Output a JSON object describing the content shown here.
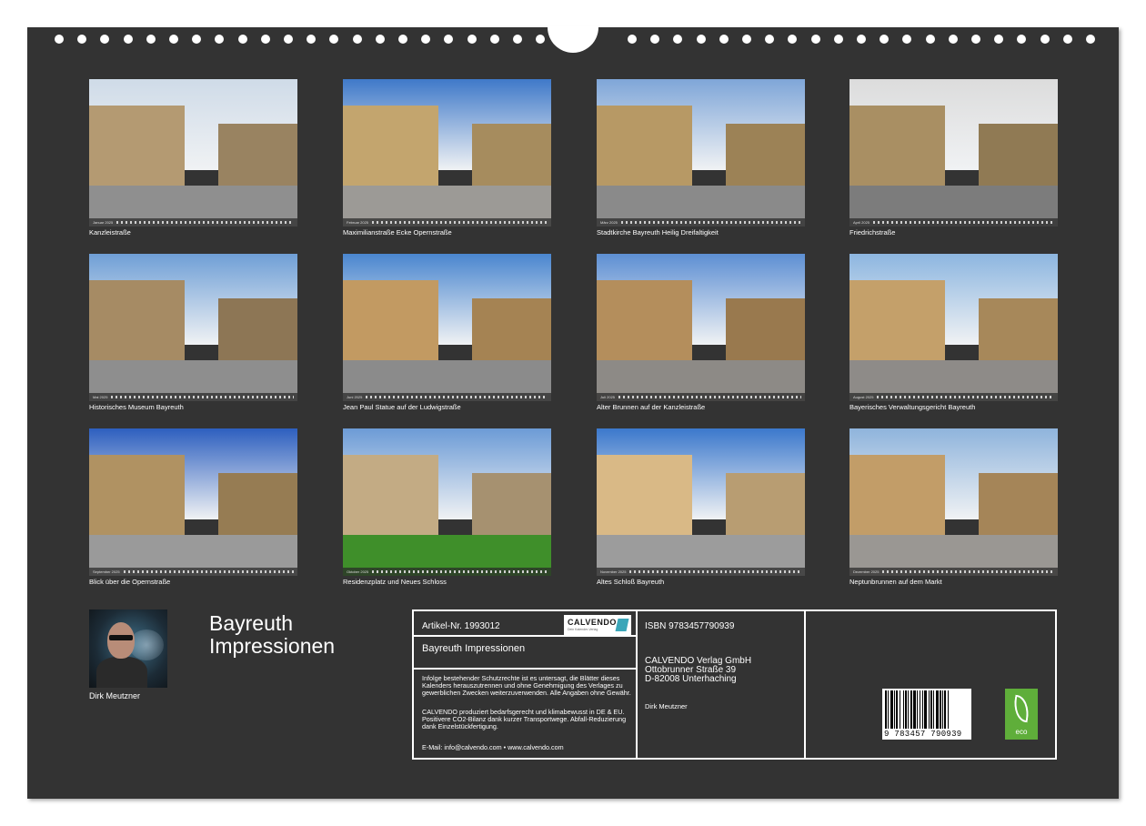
{
  "calendar": {
    "title_line1": "Bayreuth",
    "title_line2": "Impressionen",
    "author": "Dirk Meutzner"
  },
  "photos": [
    {
      "caption": "Kanzleistraße",
      "month": "Januar 2025",
      "sky": "#cfdbe8",
      "wall": "#b49a72",
      "ground": "#8f8f8f"
    },
    {
      "caption": "Maximilianstraße Ecke Opernstraße",
      "month": "Februar 2025",
      "sky": "#3f79c9",
      "wall": "#c3a56e",
      "ground": "#9c9a96"
    },
    {
      "caption": "Stadtkirche Bayreuth Heilig Dreifaltigkeit",
      "month": "März 2025",
      "sky": "#7fa6d8",
      "wall": "#b79965",
      "ground": "#8a8a8a"
    },
    {
      "caption": "Friedrichstraße",
      "month": "April 2025",
      "sky": "#dcdcdc",
      "wall": "#a98f63",
      "ground": "#7c7c7c"
    },
    {
      "caption": "Historisches Museum Bayreuth",
      "month": "Mai 2025",
      "sky": "#6f9fd6",
      "wall": "#a68b64",
      "ground": "#8e8e8e"
    },
    {
      "caption": "Jean Paul Statue auf der Ludwigstraße",
      "month": "Juni 2025",
      "sky": "#4a86cf",
      "wall": "#c29a62",
      "ground": "#8b8b8b"
    },
    {
      "caption": "Alter Brunnen auf der Kanzleistraße",
      "month": "Juli 2025",
      "sky": "#5d8fd3",
      "wall": "#b48e5c",
      "ground": "#8d8a86"
    },
    {
      "caption": "Bayerisches Verwaltungsgericht Bayreuth",
      "month": "August 2025",
      "sky": "#8db6e0",
      "wall": "#c4a06a",
      "ground": "#8e8b88"
    },
    {
      "caption": "Blick über die Opernstraße",
      "month": "September 2025",
      "sky": "#2d5fbf",
      "wall": "#b09262",
      "ground": "#9a9a9a"
    },
    {
      "caption": "Residenzplatz und Neues Schloss",
      "month": "Oktober 2025",
      "sky": "#6c9bd6",
      "wall": "#c3ab84",
      "ground": "#3f8f2a"
    },
    {
      "caption": "Altes Schloß Bayreuth",
      "month": "November 2025",
      "sky": "#3b78cc",
      "wall": "#d9b986",
      "ground": "#9c9c9c"
    },
    {
      "caption": "Neptunbrunnen auf dem Markt",
      "month": "Dezember 2025",
      "sky": "#8fb4dc",
      "wall": "#c29d68",
      "ground": "#9a9793"
    }
  ],
  "info": {
    "article": "Artikel-Nr. 1993012",
    "product_title": "Bayreuth Impressionen",
    "legal_text": "Infolge bestehender Schutzrechte ist es untersagt, die Blätter dieses Kalenders herauszutrennen und ohne Genehmigung des Verlages zu gewerblichen Zwecken weiterzuverwenden. Alle Angaben ohne Gewähr.",
    "eco_text": "CALVENDO produziert bedarfsgerecht und klimabewusst in DE & EU. Positivere CO2-Bilanz dank kurzer Transportwege. Abfall-Reduzierung dank Einzelstückfertigung.",
    "contact": "E-Mail: info@calvendo.com • www.calvendo.com",
    "isbn": "ISBN 9783457790939",
    "publisher_name": "CALVENDO Verlag GmbH",
    "publisher_street": "Ottobrunner Straße 39",
    "publisher_city": "D-82008 Unterhaching",
    "author": "Dirk Meutzner",
    "logo_word": "CALVENDO",
    "logo_tagline": "Dein Kalender-Verlag",
    "barcode_number": "9 783457 790939",
    "eco_label": "eco"
  },
  "colors": {
    "background": "#333333",
    "accent_logo": "#3aa6b9",
    "eco_green": "#5fae3a"
  }
}
